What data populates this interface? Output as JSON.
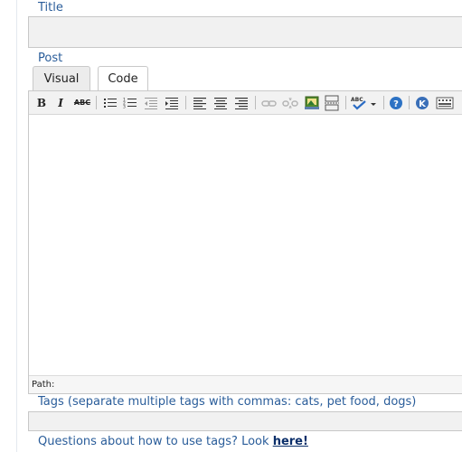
{
  "form": {
    "title_label": "Title",
    "title_value": "",
    "post_label": "Post",
    "tabs": [
      {
        "label": "Visual",
        "active": true
      },
      {
        "label": "Code",
        "active": false
      }
    ],
    "path_label": "Path:",
    "tags_label": "Tags (separate multiple tags with commas: cats, pet food, dogs)",
    "tags_value": "",
    "help_text": "Questions about how to use tags? Look ",
    "help_link": "here!"
  },
  "toolbar": {
    "bold": "B",
    "italic": "I",
    "strike": "ABC",
    "icons": [
      "bold-icon",
      "italic-icon",
      "strikethrough-icon",
      "unordered-list-icon",
      "ordered-list-icon",
      "outdent-icon",
      "indent-icon",
      "align-left-icon",
      "align-center-icon",
      "align-right-icon",
      "link-icon",
      "unlink-icon",
      "image-icon",
      "more-break-icon",
      "spellcheck-icon",
      "help-icon",
      "kitchen-sink-icon",
      "toolbar-toggle-icon"
    ]
  },
  "colors": {
    "label_blue": "#2a5d9a",
    "link_dark": "#0b2f6a",
    "help_blue": "#2d72c4"
  }
}
